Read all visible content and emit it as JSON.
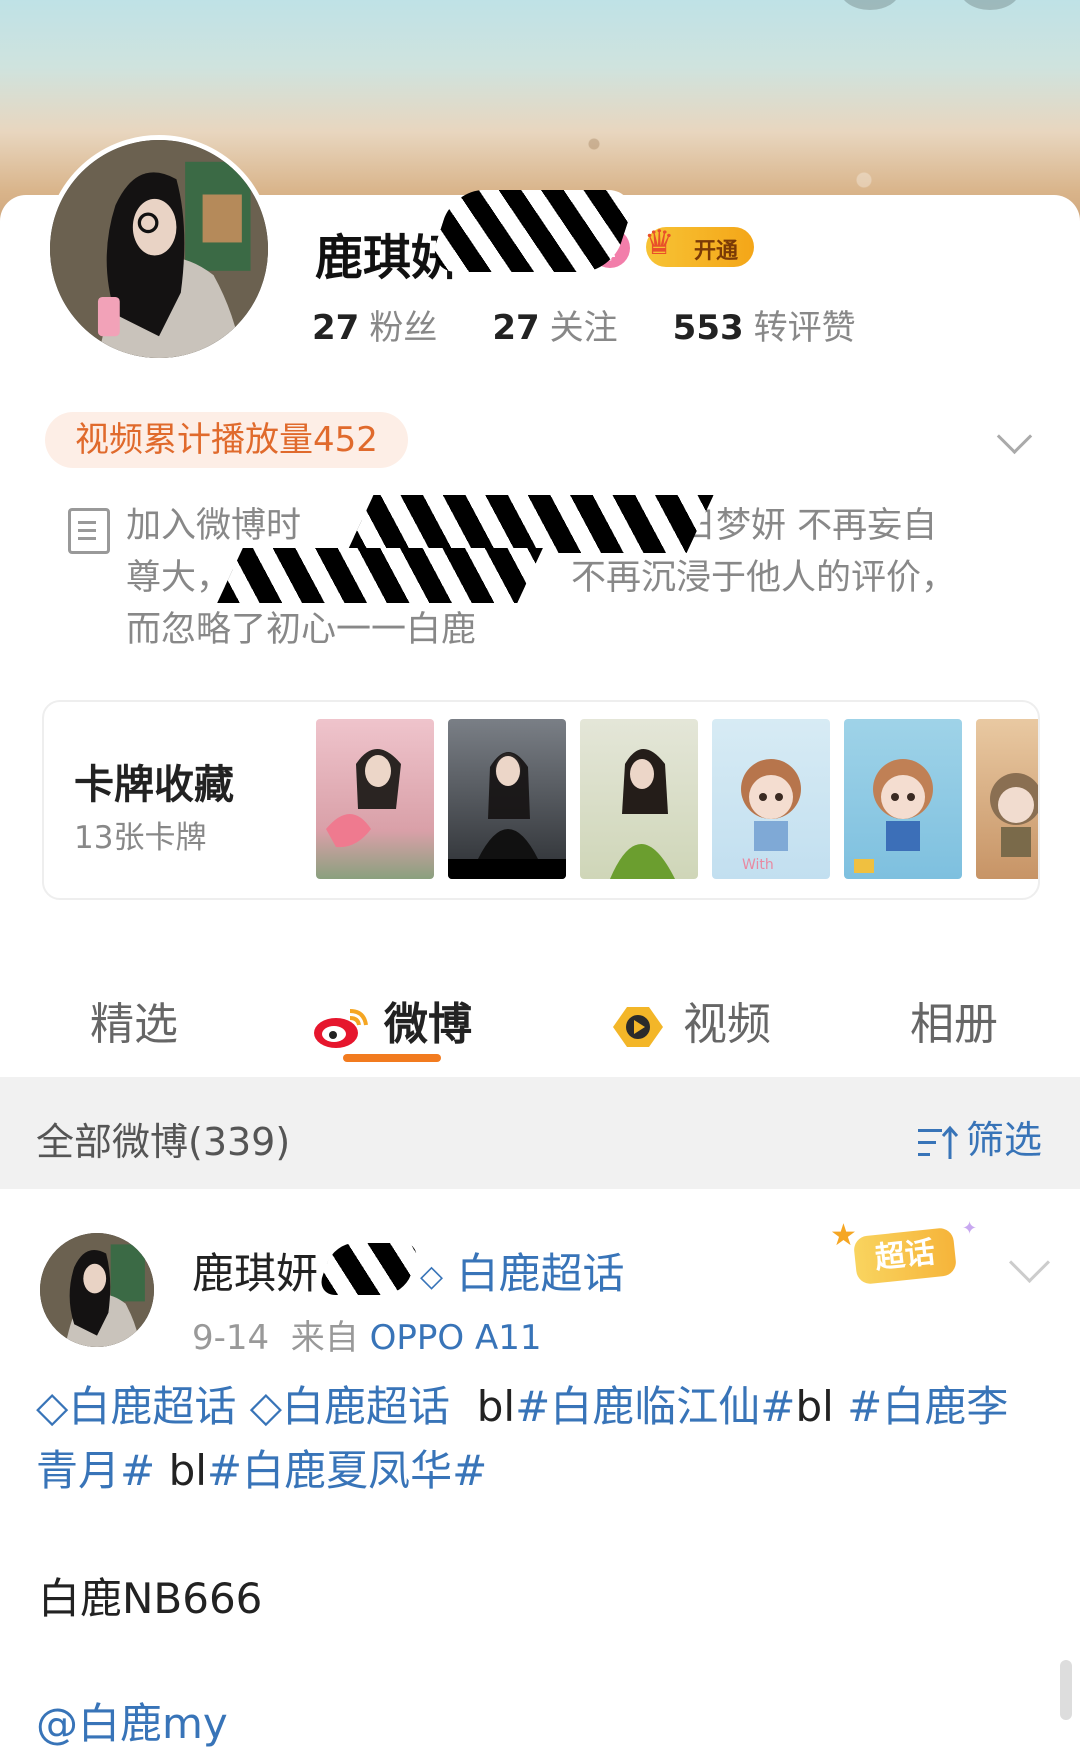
{
  "profile": {
    "name_visible": "鹿琪妍",
    "gender_symbol": "♀",
    "vip_label": "开通",
    "stats": [
      {
        "value": "27",
        "label": "粉丝"
      },
      {
        "value": "27",
        "label": "关注"
      },
      {
        "value": "553",
        "label": "转评赞"
      }
    ],
    "play_count": "视频累计播放量452",
    "bio_line1": "加入微博时",
    "bio_line1_end": "日梦妍  不再妄自",
    "bio_line2_start": "尊大，",
    "bio_line2_end": "不再沉浸于他人的评价，",
    "bio_line3": "而忽略了初心一一白鹿"
  },
  "card_collection": {
    "title": "卡牌收藏",
    "count": "13张卡牌"
  },
  "tabs": [
    {
      "label": "精选",
      "icon": ""
    },
    {
      "label": "微博",
      "icon": "weibo-logo-icon"
    },
    {
      "label": "视频",
      "icon": "video-play-icon"
    },
    {
      "label": "相册",
      "icon": ""
    }
  ],
  "filter": {
    "all_label": "全部微博(339)",
    "filter_label": "筛选"
  },
  "post": {
    "author": "鹿琪妍",
    "topic": "白鹿超话",
    "badge": "超话",
    "date": "9-14",
    "from_label": "来自",
    "device": "OPPO A11",
    "tag1": "白鹿超话",
    "tag2": "白鹿超话",
    "bl1": "bl",
    "hash1": "#白鹿临江仙#",
    "bl2": "bl",
    "hash2": "#白鹿李青月#",
    "bl3": "bl",
    "hash3": "#白鹿夏凤华#",
    "line2": "白鹿NB666",
    "mention": "@白鹿my"
  },
  "colors": {
    "accent_orange": "#f27b1f",
    "link_blue": "#3874b8",
    "play_badge_text": "#e06a2c"
  }
}
